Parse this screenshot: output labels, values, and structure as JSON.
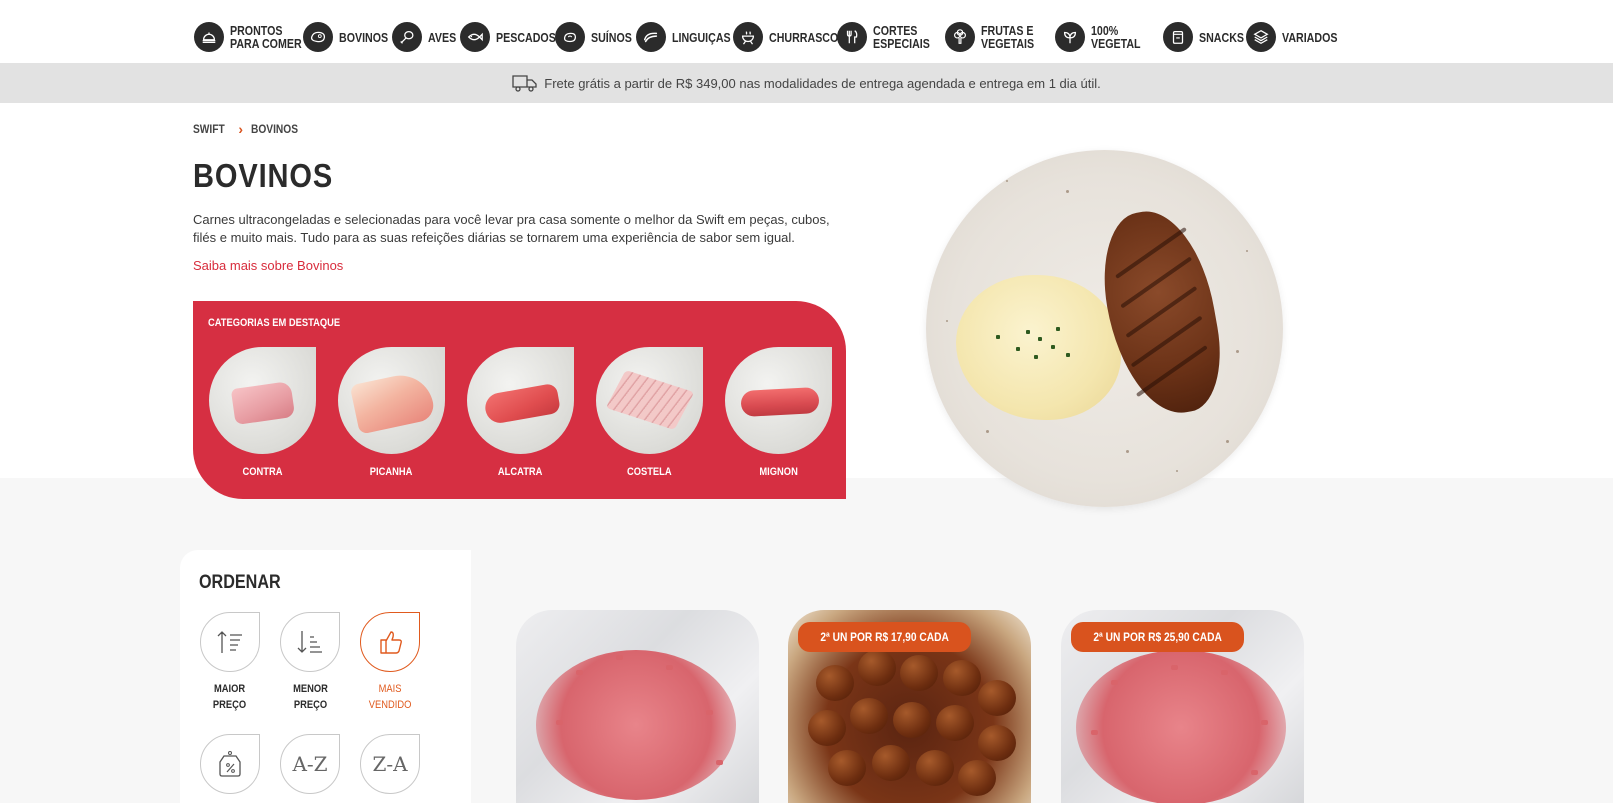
{
  "nav": {
    "items": [
      {
        "label_line1": "PRONTOS",
        "label_line2": "PARA COMER",
        "icon": "cloche-icon"
      },
      {
        "label_line1": "BOVINOS",
        "label_line2": "",
        "icon": "steak-icon"
      },
      {
        "label_line1": "AVES",
        "label_line2": "",
        "icon": "drumstick-icon"
      },
      {
        "label_line1": "PESCADOS",
        "label_line2": "",
        "icon": "fish-icon"
      },
      {
        "label_line1": "SUÍNOS",
        "label_line2": "",
        "icon": "pork-icon"
      },
      {
        "label_line1": "LINGUIÇAS",
        "label_line2": "",
        "icon": "sausage-icon"
      },
      {
        "label_line1": "CHURRASCO",
        "label_line2": "",
        "icon": "grill-icon"
      },
      {
        "label_line1": "CORTES",
        "label_line2": "ESPECIAIS",
        "icon": "cutlery-icon"
      },
      {
        "label_line1": "FRUTAS E",
        "label_line2": "VEGETAIS",
        "icon": "broccoli-icon"
      },
      {
        "label_line1": "100%",
        "label_line2": "VEGETAL",
        "icon": "leaf-icon"
      },
      {
        "label_line1": "SNACKS",
        "label_line2": "",
        "icon": "snack-bag-icon"
      },
      {
        "label_line1": "VARIADOS",
        "label_line2": "",
        "icon": "layers-icon"
      }
    ]
  },
  "shipping": {
    "text": "Frete grátis a partir de R$ 349,00 nas modalidades de entrega agendada e entrega em 1 dia útil.",
    "icon": "truck-icon"
  },
  "breadcrumb": {
    "home": "SWIFT",
    "current": "BOVINOS"
  },
  "page": {
    "title": "BOVINOS",
    "description": "Carnes ultracongeladas e selecionadas para você levar pra casa somente o melhor da Swift em peças, cubos, filés e muito mais. Tudo para as suas refeições diárias se tornarem uma experiência de sabor sem igual.",
    "learn_more": "Saiba mais sobre Bovinos"
  },
  "featured": {
    "title": "CATEGORIAS EM DESTAQUE",
    "categories": [
      {
        "label": "CONTRA"
      },
      {
        "label": "PICANHA"
      },
      {
        "label": "ALCATRA"
      },
      {
        "label": "COSTELA"
      },
      {
        "label": "MIGNON"
      }
    ]
  },
  "sort": {
    "title": "ORDENAR",
    "options": [
      {
        "line1": "MAIOR",
        "line2": "PREÇO",
        "icon": "sort-descending-icon",
        "active": false
      },
      {
        "line1": "MENOR",
        "line2": "PREÇO",
        "icon": "sort-ascending-icon",
        "active": false
      },
      {
        "line1": "MAIS",
        "line2": "VENDIDO",
        "icon": "thumbs-up-icon",
        "active": true
      },
      {
        "line1": "",
        "line2": "",
        "icon": "discount-tag-icon",
        "active": false
      },
      {
        "glyph": "A-Z",
        "icon": "a-z-icon",
        "active": false
      },
      {
        "glyph": "Z-A",
        "icon": "z-a-icon",
        "active": false
      }
    ]
  },
  "products": [
    {
      "badge": ""
    },
    {
      "badge": "2ª UN POR R$ 17,90 CADA"
    },
    {
      "badge": "2ª UN POR R$ 25,90 CADA"
    }
  ],
  "colors": {
    "accent_red": "#d62f42",
    "accent_orange": "#d9531e",
    "dark": "#2b2b2b",
    "banner_bg": "#e2e2e2"
  }
}
